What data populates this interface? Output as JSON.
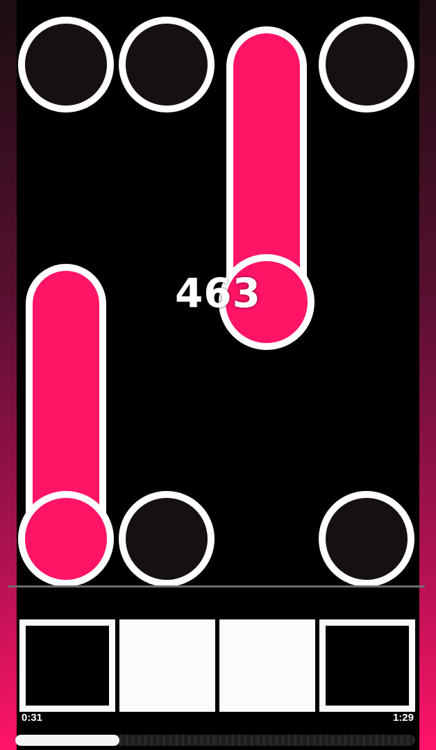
{
  "score": "463",
  "time": {
    "elapsed": "0:31",
    "total": "1:29"
  },
  "progress_fraction": 0.26,
  "colors": {
    "note_fill": "#ff1466",
    "ring_dark": "#161010",
    "outline": "#ffffff",
    "side_bar_bottom": "#ff1468"
  },
  "lanes": [
    {
      "key_lit": false
    },
    {
      "key_lit": true
    },
    {
      "key_lit": true
    },
    {
      "key_lit": false
    }
  ]
}
